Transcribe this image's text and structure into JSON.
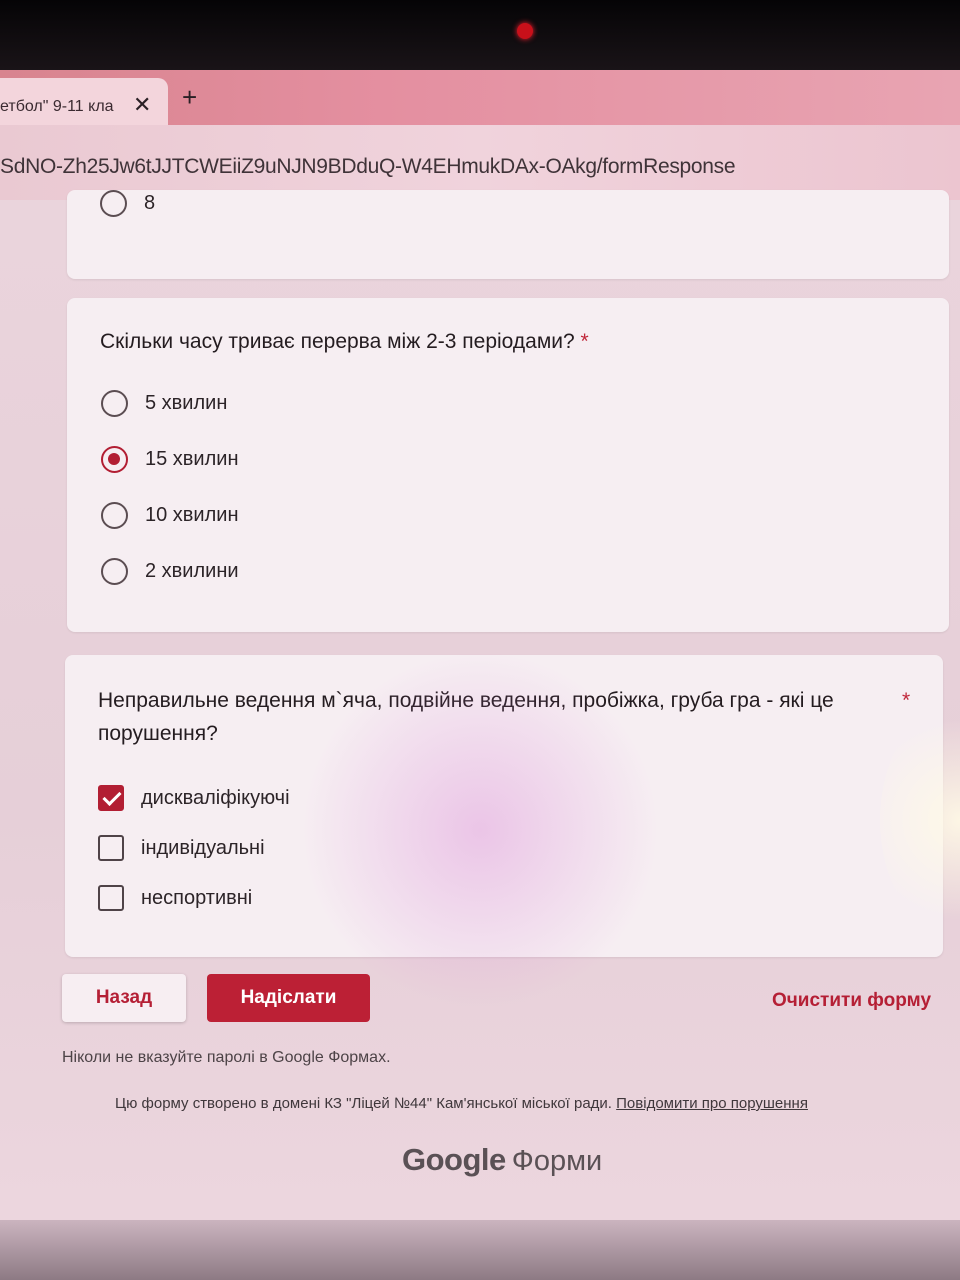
{
  "browser": {
    "tab_title": "етбол\" 9-11 кла",
    "tab_close": "✕",
    "new_tab": "+",
    "url": "SdNO-Zh25Jw6tJJTCWEiiZ9uNJN9BDduQ-W4EHmukDAx-OAkg/formResponse"
  },
  "prev_question": {
    "options": [
      {
        "label": "8",
        "checked": false
      }
    ]
  },
  "question1": {
    "title": "Скільки часу триває перерва між 2-3 періодами?",
    "required_mark": "*",
    "options": [
      {
        "label": "5 хвилин",
        "checked": false
      },
      {
        "label": "15 хвилин",
        "checked": true
      },
      {
        "label": "10 хвилин",
        "checked": false
      },
      {
        "label": "2 хвилини",
        "checked": false
      }
    ]
  },
  "question2": {
    "title_line1": "Неправильне ведення  м`яча, подвійне ведення, пробіжка, груба гра - які це",
    "title_line2": "порушення?",
    "required_mark": "*",
    "options": [
      {
        "label": "дискваліфікуючі",
        "checked": true
      },
      {
        "label": "індивідуальні",
        "checked": false
      },
      {
        "label": "неспортивні",
        "checked": false
      }
    ]
  },
  "actions": {
    "back": "Назад",
    "submit": "Надіслати",
    "clear": "Очистити форму"
  },
  "footer": {
    "password_note": "Ніколи не вказуйте паролі в Google Формах.",
    "domain_note": "Цю форму створено в домені КЗ \"Ліцей №44\" Кам'янської міської ради.",
    "report_link": "Повідомити про порушення",
    "brand_google": "Google",
    "brand_forms": "Форми"
  },
  "colors": {
    "accent": "#bc2035",
    "card": "#f6eef2",
    "page_bg": "#e9d3dc"
  }
}
